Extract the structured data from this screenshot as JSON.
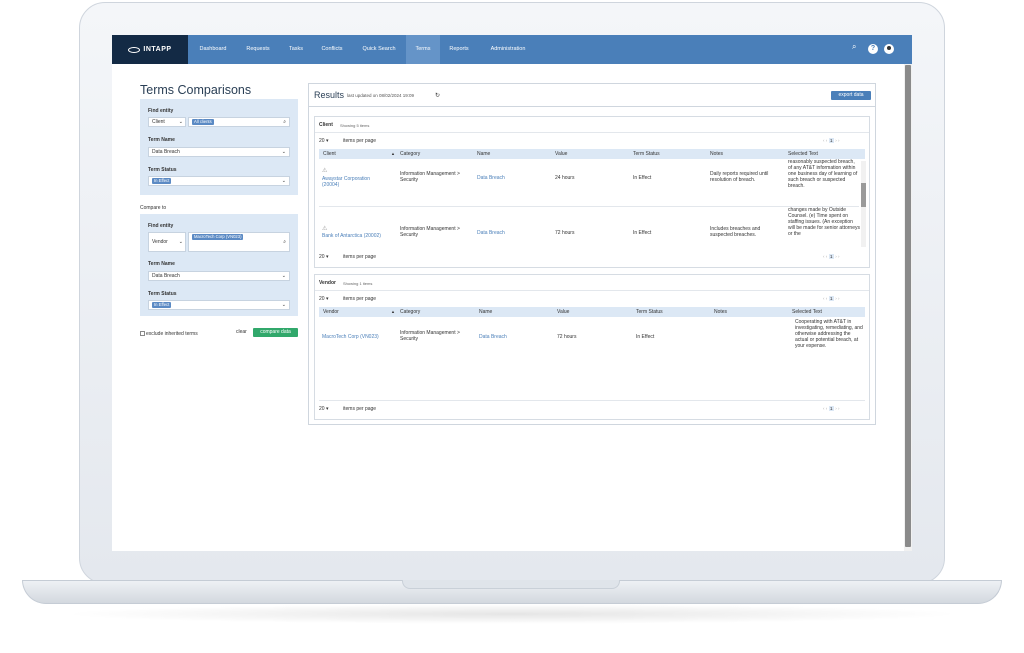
{
  "nav": {
    "logo": "INTAPP",
    "items": [
      "Dashboard",
      "Requests",
      "Tasks",
      "Conflicts",
      "Quick Search",
      "Terms",
      "Reports",
      "Administration"
    ],
    "active": "Terms"
  },
  "page": {
    "title": "Terms Comparisons"
  },
  "left": {
    "find_entity_label": "Find entity",
    "entity_type": "Client",
    "entity_chip": "All clients",
    "term_name_label": "Term Name",
    "term_name_value": "Data Breach",
    "term_status_label": "Term Status",
    "term_status_chip": "In Effect",
    "compare_to_label": "Compare to",
    "compare_entity_type": "Vendor",
    "compare_entity_chip": "MacroTech Corp (VN023)",
    "compare_term_name_value": "Data Breach",
    "compare_term_status_chip": "In Effect",
    "exclude_label": "exclude inherited terms",
    "clear_label": "clear",
    "compare_button": "compare data"
  },
  "results": {
    "title": "Results",
    "updated": "last updated on 08/02/2024 19:09",
    "export_button": "export data",
    "client_section": {
      "title": "Client",
      "showing": "Showing 5 items",
      "per_page": "20",
      "per_page_label": "items per page",
      "page": "1",
      "columns": [
        "Client",
        "Category",
        "Name",
        "Value",
        "Term Status",
        "Notes",
        "Selected Text"
      ],
      "rows": [
        {
          "client": "Awaystar Corporation (20004)",
          "category": "Information Management > Security",
          "name": "Data Breach",
          "value": "24 hours",
          "status": "In Effect",
          "notes": "Daily reports required until resolution of breach.",
          "selected": "reasonably suspected breach, of any AT&T information within one business day of learning of such breach or suspected breach."
        },
        {
          "client": "Bank of Antarctica (20002)",
          "category": "Information Management > Security",
          "name": "Data Breach",
          "value": "72 hours",
          "status": "In Effect",
          "notes": "Includes breaches and suspected breaches.",
          "selected": "changes made by Outside Counsel. (e) Time spent on staffing issues. (An exception will be made for senior attorneys or the"
        }
      ]
    },
    "vendor_section": {
      "title": "Vendor",
      "showing": "Showing 1 items",
      "per_page": "20",
      "per_page_label": "items per page",
      "page": "1",
      "columns": [
        "Vendor",
        "Category",
        "Name",
        "Value",
        "Term Status",
        "Notes",
        "Selected Text"
      ],
      "rows": [
        {
          "vendor": "MacroTech Corp (VN023)",
          "category": "Information Management > Security",
          "name": "Data Breach",
          "value": "72 hours",
          "status": "In Effect",
          "notes": "",
          "selected": "Cooperating with AT&T in investigating, remediating, and otherwise addressing the actual or potential breach, at your expense."
        }
      ],
      "footer_per_page": "20",
      "footer_per_page_label": "items per page"
    }
  },
  "colors": {
    "nav": "#4a7fb9",
    "logo_bg": "#132a45",
    "accent_green": "#31a86b",
    "panel_blue": "#dce8f5"
  }
}
